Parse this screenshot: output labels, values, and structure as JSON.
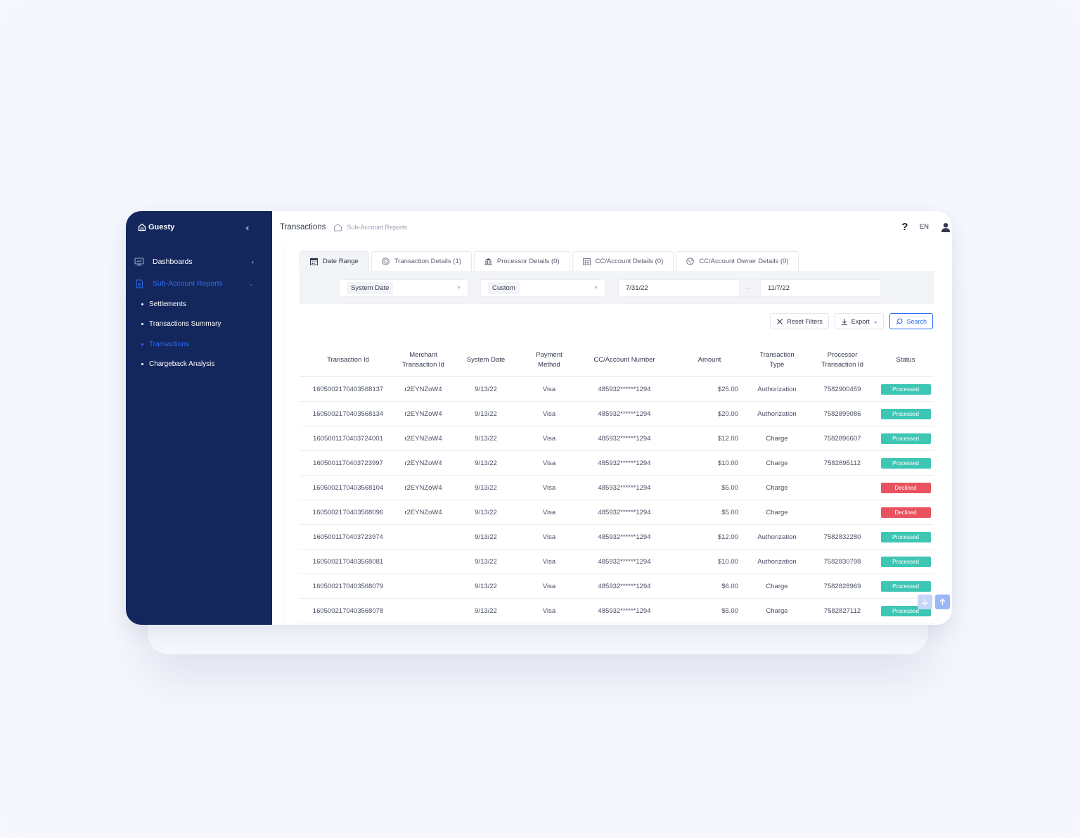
{
  "brand": {
    "name": "Guesty",
    "accent": "#2d6cf5",
    "sidebar_bg": "#14275c"
  },
  "sidebar": {
    "nav": [
      {
        "label": "Dashboards",
        "icon": "monitor-icon"
      },
      {
        "label": "Sub-Account Reports",
        "icon": "document-icon"
      }
    ],
    "sub_items": [
      {
        "label": "Settlements"
      },
      {
        "label": "Transactions Summary"
      },
      {
        "label": "Transactions"
      },
      {
        "label": "Chargeback Analysis"
      }
    ]
  },
  "header": {
    "title": "Transactions",
    "breadcrumb": "Sub-Account Reports",
    "help": "?",
    "language": "EN"
  },
  "tabs": [
    {
      "label": "Date Range"
    },
    {
      "label": "Transaction Details (1)"
    },
    {
      "label": "Processor Details (0)"
    },
    {
      "label": "CC/Account Details (0)"
    },
    {
      "label": "CC/Account Owner Details (0)"
    }
  ],
  "filters": {
    "date_field": "System Date",
    "range_type": "Custom",
    "date_from": "7/31/22",
    "separator": "···",
    "date_to": "11/7/22"
  },
  "actions": {
    "reset": "Reset Filters",
    "export": "Export",
    "search": "Search"
  },
  "table": {
    "columns": [
      [
        "Transaction Id"
      ],
      [
        "Merchant",
        "Transaction Id"
      ],
      [
        "System Date"
      ],
      [
        "Payment",
        "Method"
      ],
      [
        "CC/Account Number"
      ],
      [
        "Amount"
      ],
      [
        "Transaction",
        "Type"
      ],
      [
        "Processor",
        "Transaction Id"
      ],
      [
        "Status"
      ]
    ],
    "rows": [
      [
        "1605002170403568137",
        "r2EYNZoW4",
        "9/13/22",
        "Visa",
        "485932******1294",
        "$25.00",
        "Authorization",
        "7582900459",
        "Processed"
      ],
      [
        "1605002170403568134",
        "r2EYNZoW4",
        "9/13/22",
        "Visa",
        "485932******1294",
        "$20.00",
        "Authorization",
        "7582899086",
        "Processed"
      ],
      [
        "1605001170403724001",
        "r2EYNZoW4",
        "9/13/22",
        "Visa",
        "485932******1294",
        "$12.00",
        "Charge",
        "7582896607",
        "Processed"
      ],
      [
        "1605001170403723997",
        "r2EYNZoW4",
        "9/13/22",
        "Visa",
        "485932******1294",
        "$10.00",
        "Charge",
        "7582895112",
        "Processed"
      ],
      [
        "1605002170403568104",
        "r2EYNZoW4",
        "9/13/22",
        "Visa",
        "485932******1294",
        "$5.00",
        "Charge",
        "",
        "Declined"
      ],
      [
        "1605002170403568096",
        "r2EYNZoW4",
        "9/13/22",
        "Visa",
        "485932******1294",
        "$5.00",
        "Charge",
        "",
        "Declined"
      ],
      [
        "1605001170403723974",
        "",
        "9/13/22",
        "Visa",
        "485932******1294",
        "$12.00",
        "Authorization",
        "7582832280",
        "Processed"
      ],
      [
        "1605002170403568081",
        "",
        "9/13/22",
        "Visa",
        "485932******1294",
        "$10.00",
        "Authorization",
        "7582830798",
        "Processed"
      ],
      [
        "1605002170403568079",
        "",
        "9/13/22",
        "Visa",
        "485932******1294",
        "$6.00",
        "Charge",
        "7582828969",
        "Processed"
      ],
      [
        "1605002170403568078",
        "",
        "9/13/22",
        "Visa",
        "485932******1294",
        "$5.00",
        "Charge",
        "7582827112",
        "Processed"
      ]
    ]
  },
  "status_colors": {
    "Processed": "#3ec6b4",
    "Declined": "#e9525f"
  }
}
